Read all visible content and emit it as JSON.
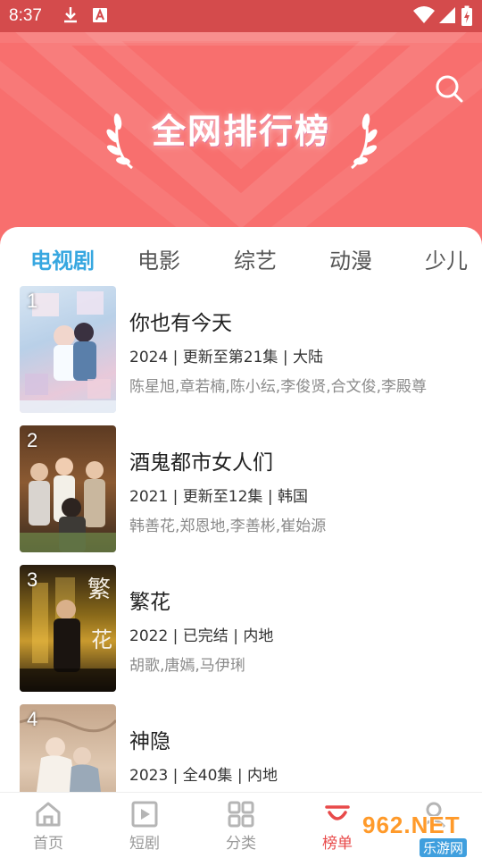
{
  "status_bar": {
    "time": "8:37"
  },
  "header": {
    "title": "全网排行榜"
  },
  "tabs": [
    {
      "label": "电视剧",
      "active": true
    },
    {
      "label": "电影",
      "active": false
    },
    {
      "label": "综艺",
      "active": false
    },
    {
      "label": "动漫",
      "active": false
    },
    {
      "label": "少儿",
      "active": false
    }
  ],
  "items": [
    {
      "rank": "1",
      "title": "你也有今天",
      "meta": "2024 | 更新至第21集 | 大陆",
      "cast": "陈星旭,章若楠,陈小纭,李俊贤,合文俊,李殿尊"
    },
    {
      "rank": "2",
      "title": "酒鬼都市女人们",
      "meta": "2021 | 更新至12集 | 韩国",
      "cast": "韩善花,郑恩地,李善彬,崔始源"
    },
    {
      "rank": "3",
      "title": "繁花",
      "meta": "2022 | 已完结 | 内地",
      "cast": "胡歌,唐嫣,马伊琍"
    },
    {
      "rank": "4",
      "title": "神隐",
      "meta": "2023 | 全40集 | 内地",
      "cast": ""
    }
  ],
  "bottom_nav": [
    {
      "label": "首页",
      "icon": "home-icon",
      "active": false
    },
    {
      "label": "短剧",
      "icon": "play-square-icon",
      "active": false
    },
    {
      "label": "分类",
      "icon": "grid-icon",
      "active": false
    },
    {
      "label": "榜单",
      "icon": "ranking-icon",
      "active": true
    },
    {
      "label": "",
      "icon": "profile-icon",
      "active": false
    }
  ],
  "watermark": {
    "brand": "962.NET",
    "sub": "乐游网"
  },
  "colors": {
    "status_bar": "#d44b4c",
    "banner": "#f86f6e",
    "tab_active": "#37a7e0",
    "nav_active": "#e84a4a"
  }
}
